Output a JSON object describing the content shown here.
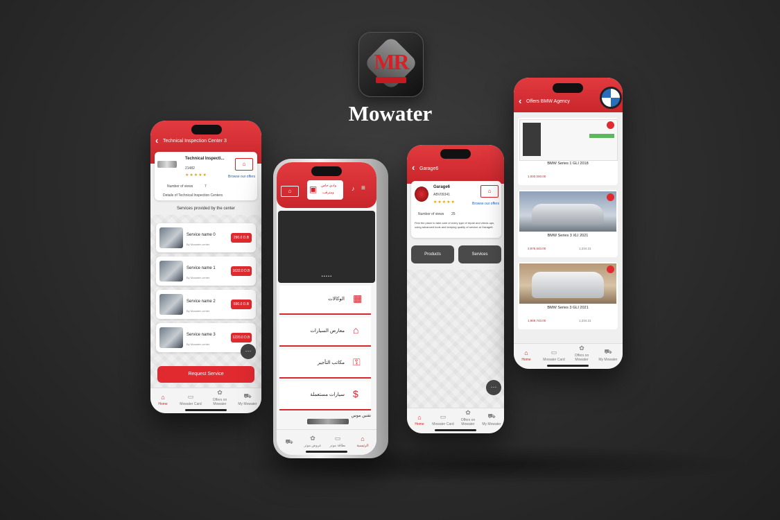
{
  "brand": {
    "name": "Mowater"
  },
  "phone_left": {
    "header_title": "Technical Inspection Center 3",
    "center_name": "Technical Inspecti...",
    "center_sub": "21482",
    "stars": "★★★★★",
    "browse_link": "Browse our offers",
    "views_label": "Number of views",
    "views_value": "7",
    "details": "Details of Technical Inspection Centers",
    "section_title": "Services provided by the center",
    "services": [
      {
        "name": "Service name 0",
        "sub": "By Mowater center",
        "price": "290.0 D.B"
      },
      {
        "name": "Service name 1",
        "sub": "By Mowater center",
        "price": "1632.0 D.B"
      },
      {
        "name": "Service name 2",
        "sub": "By Mowater center",
        "price": "690.0 D.B"
      },
      {
        "name": "Service name 3",
        "sub": "By Mowater center",
        "price": "1220.0 D.B"
      }
    ],
    "fab": "···",
    "request_button": "Request Service",
    "nav": [
      {
        "label": "Home",
        "icon": "⌂"
      },
      {
        "label": "Mowater Card",
        "icon": "▭"
      },
      {
        "label": "Offers on Mowater",
        "icon": "✿"
      },
      {
        "label": "My Mowater",
        "icon": "⛟"
      }
    ]
  },
  "phone_center": {
    "header_badge_line1": "وادي خاص",
    "header_badge_line2": "ومترقب",
    "banner_dots": "• • • • •",
    "menu": [
      {
        "label": "الوكالات",
        "icon": "▦"
      },
      {
        "label": "معارض السيارات",
        "icon": "⌂"
      },
      {
        "label": "مكاتب التأجير",
        "icon": "⚿"
      },
      {
        "label": "سيارات مستعملة",
        "icon": "$"
      }
    ],
    "bottom_label": "تقنين موس",
    "nav": [
      {
        "label": "الرئيسية",
        "icon": "⌂"
      },
      {
        "label": "بطاقة موتر",
        "icon": "▭"
      },
      {
        "label": "عروض موتر",
        "icon": "✿"
      },
      {
        "label": "",
        "icon": "⛟"
      }
    ]
  },
  "phone_right_mid": {
    "header_title": "Garage6",
    "garage_name": "Garage6",
    "garage_sub": "ABV09341",
    "stars": "★★★★★",
    "browse_link": "Browse our offers",
    "views_label": "Number of views",
    "views_value": "25",
    "description": "First the place to take care of every type of repair and check-ups, using advanced tools and keeping quality of service at Garage6.",
    "products_button": "Products",
    "services_button": "Services",
    "fab": "···",
    "nav": [
      {
        "label": "Home",
        "icon": "⌂"
      },
      {
        "label": "Mowater Card",
        "icon": "▭"
      },
      {
        "label": "Offers on Mowater",
        "icon": "✿"
      },
      {
        "label": "My Mowater",
        "icon": "⛟"
      }
    ]
  },
  "phone_right": {
    "header_title": "Offers BMW Agency",
    "cars": [
      {
        "title": "BMW Series 1 GLI 2018",
        "price": "1,000,000.00",
        "old": ""
      },
      {
        "title": "BMW Series 3 XLI 2021",
        "price": "3,876,543.00",
        "old": "1,234.31"
      },
      {
        "title": "BMW Series 3 GLI 2021",
        "price": "1,969,743.00",
        "old": "1,234.31"
      }
    ],
    "nav": [
      {
        "label": "Home",
        "icon": "⌂"
      },
      {
        "label": "Mowater Card",
        "icon": "▭"
      },
      {
        "label": "Offers on Mowater",
        "icon": "✿"
      },
      {
        "label": "My Mowater",
        "icon": "⛟"
      }
    ]
  }
}
